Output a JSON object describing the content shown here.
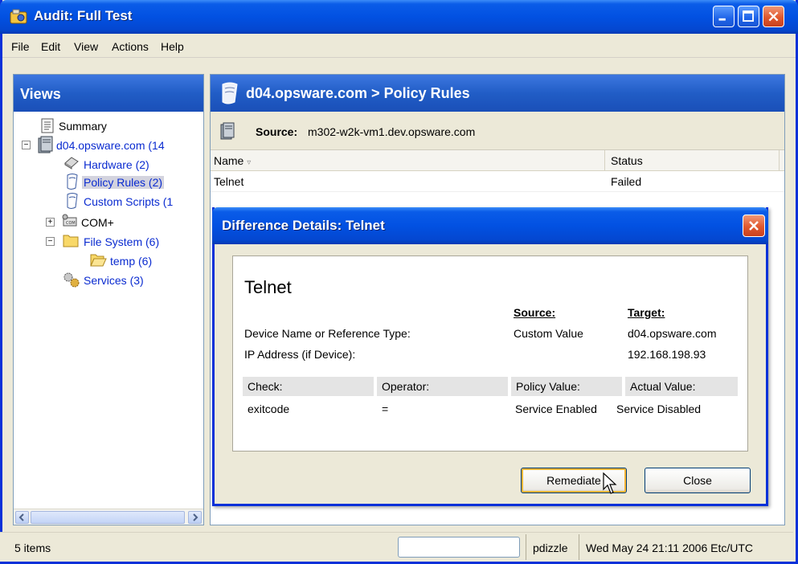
{
  "window": {
    "title": "Audit: Full Test"
  },
  "menu": [
    "File",
    "Edit",
    "View",
    "Actions",
    "Help"
  ],
  "views": {
    "header": "Views",
    "tree": {
      "summary": "Summary",
      "server": "d04.opsware.com (14",
      "hardware": "Hardware (2)",
      "policy_rules": "Policy Rules (2)",
      "custom_scripts": "Custom Scripts (1",
      "com_plus": "COM+",
      "file_system": "File System (6)",
      "temp": "temp (6)",
      "services": "Services (3)"
    }
  },
  "main": {
    "header": "d04.opsware.com > Policy Rules",
    "source_label": "Source:",
    "source_value": "m302-w2k-vm1.dev.opsware.com",
    "columns": {
      "name": "Name",
      "status": "Status"
    },
    "rows": [
      {
        "name": "Telnet",
        "status": "Failed"
      }
    ]
  },
  "dialog": {
    "title": "Difference Details: Telnet",
    "heading": "Telnet",
    "source_header": "Source:",
    "target_header": "Target:",
    "device_label": "Device Name or Reference Type:",
    "device_source": "Custom Value",
    "device_target": "d04.opsware.com",
    "ip_label": "IP Address (if Device):",
    "ip_target": "192.168.198.93",
    "check_headers": {
      "check": "Check:",
      "operator": "Operator:",
      "policy_value": "Policy Value:",
      "actual_value": "Actual Value:"
    },
    "check_row": {
      "check": "exitcode",
      "operator": "=",
      "policy_value": "Service Enabled",
      "actual_value": "Service Disabled"
    },
    "remediate_label": "Remediate",
    "close_label": "Close"
  },
  "status": {
    "items": "5 items",
    "user": "pdizzle",
    "datetime": "Wed May 24 21:11 2006 Etc/UTC"
  },
  "colors": {
    "titlebar": "#0251e2",
    "panel_header": "#215dc6",
    "link": "#0a2bd0",
    "window_face": "#ece9d8",
    "close_button": "#e1582e"
  }
}
